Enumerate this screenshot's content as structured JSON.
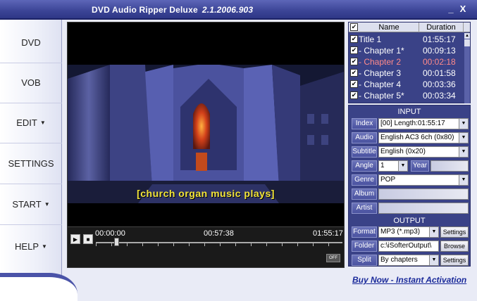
{
  "window": {
    "title": "DVD Audio Ripper Deluxe",
    "version": "2.1.2006.903",
    "minimize_label": "_",
    "close_label": "X"
  },
  "sidebar": {
    "items": [
      {
        "label": "DVD",
        "arrow": ""
      },
      {
        "label": "VOB",
        "arrow": ""
      },
      {
        "label": "EDIT",
        "arrow": "▼"
      },
      {
        "label": "SETTINGS",
        "arrow": ""
      },
      {
        "label": "START",
        "arrow": "▼"
      },
      {
        "label": "HELP",
        "arrow": "▼"
      }
    ]
  },
  "player": {
    "subtitle": "[church organ music plays]",
    "time_start": "00:00:00",
    "time_mid": "00:57:38",
    "time_end": "01:55:17",
    "play_icon": "▶",
    "stop_icon": "■",
    "off_label": "OFF"
  },
  "playlist": {
    "columns": {
      "name": "Name",
      "duration": "Duration"
    },
    "header_checked": "✔",
    "rows": [
      {
        "name": "Title 1",
        "duration": "01:55:17",
        "checked": "✔",
        "selected": false
      },
      {
        "name": "- Chapter 1*",
        "duration": "00:09:13",
        "checked": "✔",
        "selected": false
      },
      {
        "name": "- Chapter 2",
        "duration": "00:02:18",
        "checked": "✔",
        "selected": true
      },
      {
        "name": "- Chapter 3",
        "duration": "00:01:58",
        "checked": "✔",
        "selected": false
      },
      {
        "name": "- Chapter 4",
        "duration": "00:03:36",
        "checked": "✔",
        "selected": false
      },
      {
        "name": "- Chapter 5*",
        "duration": "00:03:34",
        "checked": "✔",
        "selected": false
      }
    ]
  },
  "input": {
    "title": "INPUT",
    "index_label": "Index",
    "index_value": "[00] Length:01:55:17",
    "audio_label": "Audio",
    "audio_value": "English AC3 6ch (0x80)",
    "subtitle_label": "Subtitle",
    "subtitle_value": "English (0x20)",
    "angle_label": "Angle",
    "angle_value": "1",
    "year_label": "Year",
    "year_value": "",
    "genre_label": "Genre",
    "genre_value": "POP",
    "album_label": "Album",
    "album_value": "",
    "artist_label": "Artist",
    "artist_value": ""
  },
  "output": {
    "title": "OUTPUT",
    "format_label": "Format",
    "format_value": "MP3 (*.mp3)",
    "format_settings": "Settings",
    "folder_label": "Folder",
    "folder_value": "c:\\iSofterOutput\\",
    "browse_label": "Browse",
    "split_label": "Split",
    "split_value": "By chapters",
    "split_settings": "Settings"
  },
  "buy_link": "Buy Now - Instant Activation",
  "colors": {
    "accent": "#3a4287",
    "selected_text": "#ff8a8a",
    "subtitle": "#f3e53a"
  }
}
